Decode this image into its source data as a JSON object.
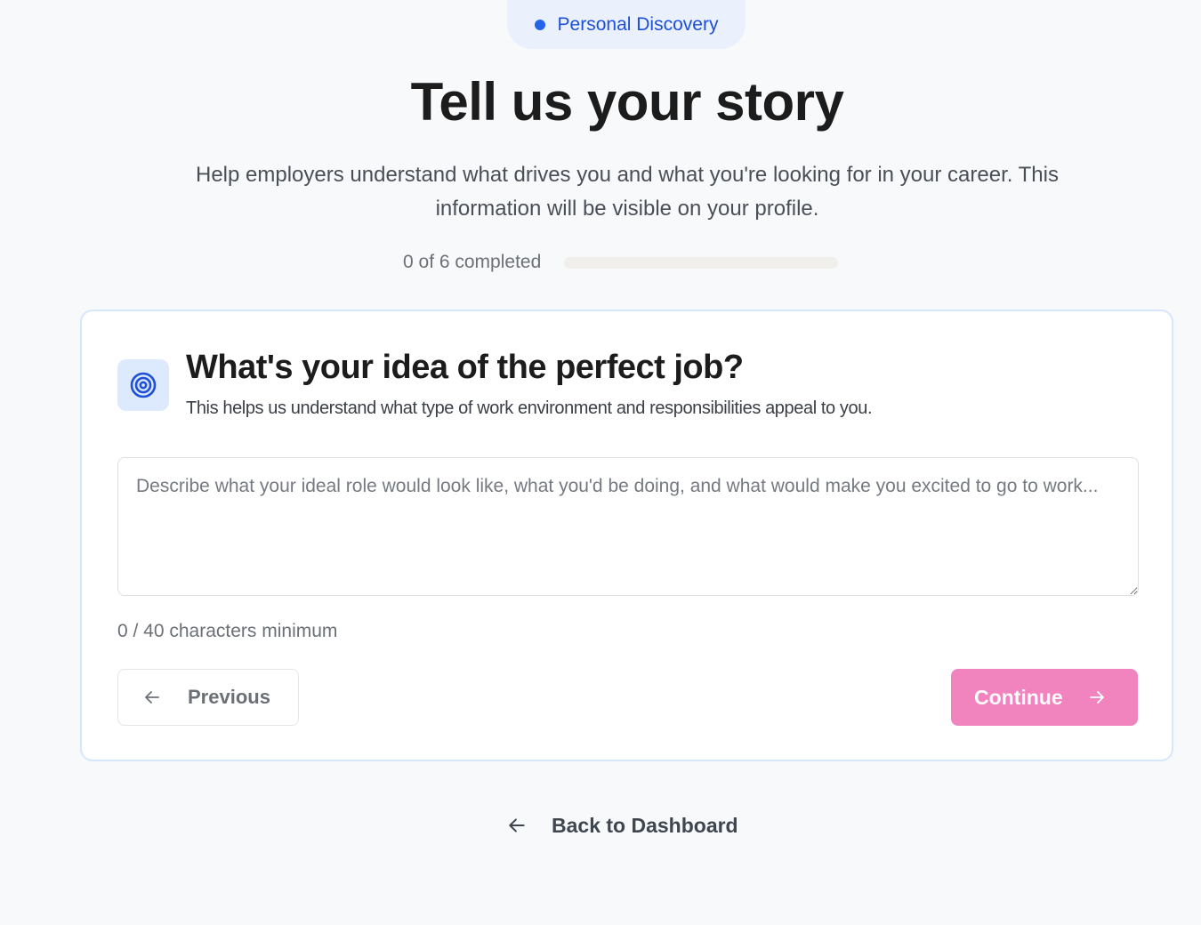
{
  "badge": {
    "label": "Personal Discovery",
    "color": "#2563eb"
  },
  "header": {
    "title": "Tell us your story",
    "subtitle": "Help employers understand what drives you and what you're looking for in your career. This information will be visible on your profile."
  },
  "progress": {
    "text": "0 of 6 completed",
    "completed": 0,
    "total": 6,
    "fraction": 0
  },
  "question": {
    "icon": "target-icon",
    "title": "What's your idea of the perfect job?",
    "help": "This helps us understand what type of work environment and responsibilities appeal to you.",
    "answer_value": "",
    "answer_placeholder": "Describe what your ideal role would look like, what you'd be doing, and what would make you excited to go to work...",
    "char_count": "0 / 40 characters minimum"
  },
  "nav": {
    "previous_label": "Previous",
    "continue_label": "Continue",
    "back_label": "Back to Dashboard"
  },
  "colors": {
    "accent": "#2563eb",
    "continue": "#f183be",
    "icon_bg": "#dde9fc"
  }
}
